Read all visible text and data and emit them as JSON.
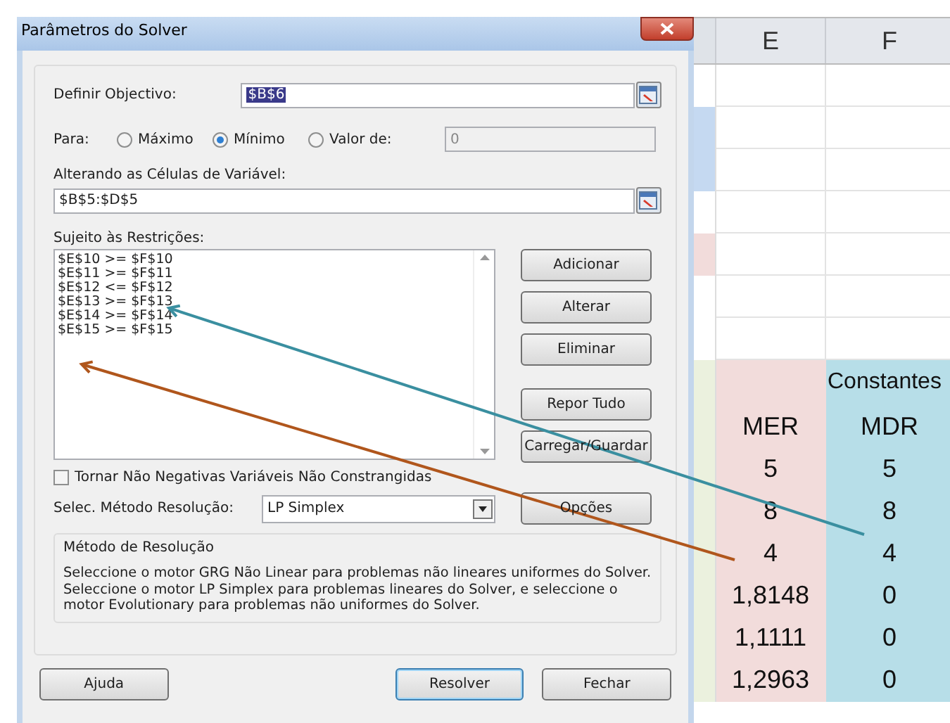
{
  "dialog": {
    "title": "Parâmetros do Solver",
    "objective": {
      "label": "Definir Objectivo:",
      "value": "$B$6"
    },
    "to": {
      "label": "Para:",
      "options": [
        {
          "label": "Máximo",
          "selected": false
        },
        {
          "label": "Mínimo",
          "selected": true
        },
        {
          "label": "Valor de:",
          "selected": false
        }
      ],
      "value_field": "0"
    },
    "variables": {
      "label": "Alterando as Células de Variável:",
      "value": "$B$5:$D$5"
    },
    "constraints": {
      "label": "Sujeito às Restrições:",
      "items": [
        "$E$10 >= $F$10",
        "$E$11 >= $F$11",
        "$E$12 <= $F$12",
        "$E$13 >= $F$13",
        "$E$14 >= $F$14",
        "$E$15 >= $F$15"
      ]
    },
    "side_buttons": [
      "Adicionar",
      "Alterar",
      "Eliminar",
      "Repor Tudo",
      "Carregar/Guardar"
    ],
    "nonnegative": {
      "label": "Tornar Não Negativas Variáveis Não Constrangidas",
      "checked": false
    },
    "method": {
      "label": "Selec. Método Resolução:",
      "value": "LP Simplex",
      "options_button": "Opções"
    },
    "method_group": {
      "title": "Método de Resolução",
      "text": "Seleccione o motor GRG Não Linear para problemas não lineares uniformes do Solver. Seleccione o motor LP Simplex para problemas lineares do Solver, e seleccione o motor Evolutionary para problemas não uniformes do Solver."
    },
    "buttons": [
      "Ajuda",
      "Resolver",
      "Fechar"
    ]
  },
  "sheet": {
    "columns": [
      "E",
      "F"
    ],
    "rows": [
      {
        "edge": {
          "color": "#ffffff"
        },
        "cells": [
          {
            "text": "",
            "color": "#ffffff"
          },
          {
            "text": "",
            "color": "#ffffff"
          }
        ]
      },
      {
        "edge": {
          "color": "#c5d9f1"
        },
        "cells": [
          {
            "text": "",
            "color": "#ffffff"
          },
          {
            "text": "",
            "color": "#ffffff"
          }
        ]
      },
      {
        "edge": {
          "color": "#c5d9f1"
        },
        "cells": [
          {
            "text": "",
            "color": "#ffffff"
          },
          {
            "text": "",
            "color": "#ffffff"
          }
        ]
      },
      {
        "edge": {
          "color": "#ffffff"
        },
        "cells": [
          {
            "text": "",
            "color": "#ffffff"
          },
          {
            "text": "",
            "color": "#ffffff"
          }
        ]
      },
      {
        "edge": {
          "color": "#f2dcdb"
        },
        "cells": [
          {
            "text": "",
            "color": "#ffffff"
          },
          {
            "text": "",
            "color": "#ffffff"
          }
        ]
      },
      {
        "edge": {
          "color": "#ffffff"
        },
        "cells": [
          {
            "text": "",
            "color": "#ffffff"
          },
          {
            "text": "",
            "color": "#ffffff"
          }
        ]
      },
      {
        "edge": {
          "color": "#ffffff"
        },
        "cells": [
          {
            "text": "",
            "color": "#ffffff"
          },
          {
            "text": "",
            "color": "#ffffff"
          }
        ]
      },
      {
        "edge": {
          "color": "#ebf1de"
        },
        "cells": [
          {
            "text": "",
            "color": "#f2dcdb"
          },
          {
            "text": "Constantes",
            "color": "#b7dee8"
          }
        ]
      },
      {
        "edge": {
          "color": "#ebf1de"
        },
        "cells": [
          {
            "text": "MER",
            "color": "#f2dcdb"
          },
          {
            "text": "MDR",
            "color": "#b7dee8"
          }
        ]
      },
      {
        "edge": {
          "color": "#ebf1de"
        },
        "cells": [
          {
            "text": "5",
            "color": "#f2dcdb"
          },
          {
            "text": "5",
            "color": "#b7dee8"
          }
        ]
      },
      {
        "edge": {
          "color": "#ebf1de"
        },
        "cells": [
          {
            "text": "8",
            "color": "#f2dcdb"
          },
          {
            "text": "8",
            "color": "#b7dee8"
          }
        ]
      },
      {
        "edge": {
          "color": "#ebf1de"
        },
        "cells": [
          {
            "text": "4",
            "color": "#f2dcdb"
          },
          {
            "text": "4",
            "color": "#b7dee8"
          }
        ]
      },
      {
        "edge": {
          "color": "#ebf1de"
        },
        "cells": [
          {
            "text": "1,8148",
            "color": "#f2dcdb"
          },
          {
            "text": "0",
            "color": "#b7dee8"
          }
        ]
      },
      {
        "edge": {
          "color": "#ebf1de"
        },
        "cells": [
          {
            "text": "1,1111",
            "color": "#f2dcdb"
          },
          {
            "text": "0",
            "color": "#b7dee8"
          }
        ]
      },
      {
        "edge": {
          "color": "#ebf1de"
        },
        "cells": [
          {
            "text": "1,2963",
            "color": "#f2dcdb"
          },
          {
            "text": "0",
            "color": "#b7dee8"
          }
        ]
      }
    ]
  }
}
